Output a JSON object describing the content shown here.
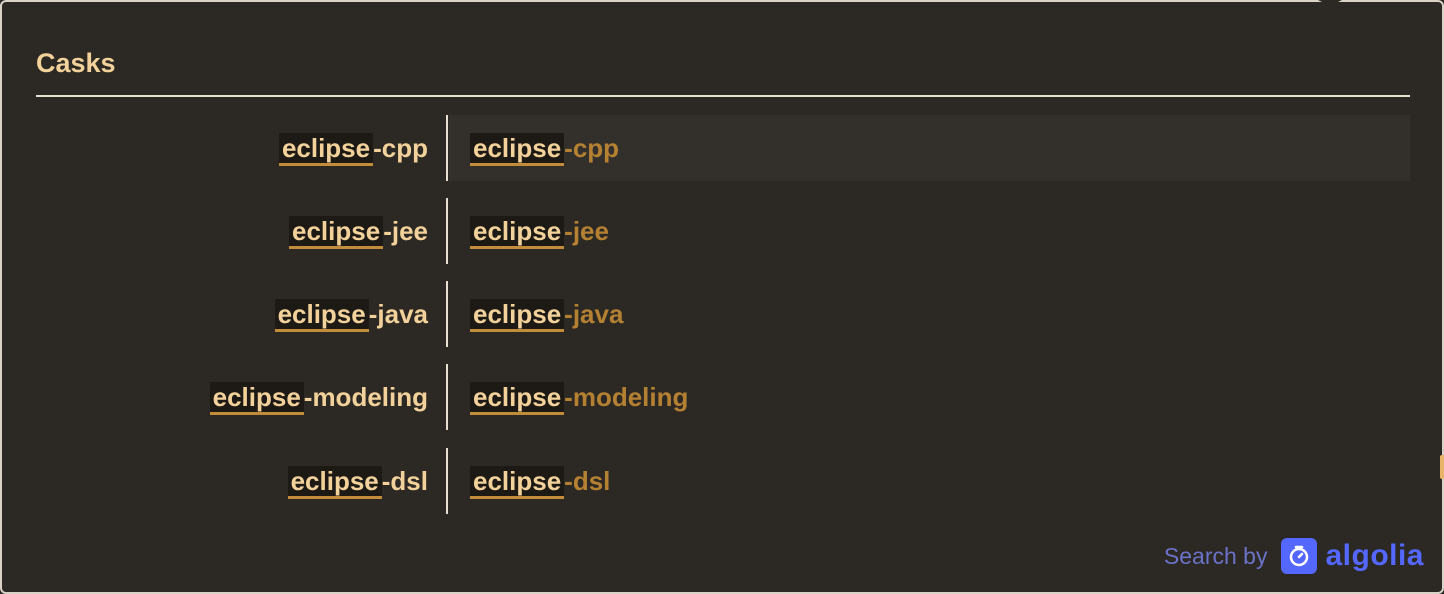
{
  "category": {
    "title": "Casks"
  },
  "results": [
    {
      "left_match": "eclipse",
      "left_rest": "-cpp",
      "right_match": "eclipse",
      "right_rest": "-cpp",
      "active": true
    },
    {
      "left_match": "eclipse",
      "left_rest": "-jee",
      "right_match": "eclipse",
      "right_rest": "-jee",
      "active": false
    },
    {
      "left_match": "eclipse",
      "left_rest": "-java",
      "right_match": "eclipse",
      "right_rest": "-java",
      "active": false
    },
    {
      "left_match": "eclipse",
      "left_rest": "-modeling",
      "right_match": "eclipse",
      "right_rest": "-modeling",
      "active": false
    },
    {
      "left_match": "eclipse",
      "left_rest": "-dsl",
      "right_match": "eclipse",
      "right_rest": "-dsl",
      "active": false
    }
  ],
  "footer": {
    "search_by": "Search by",
    "brand": "algolia",
    "brand_icon": "algolia-stopwatch-icon",
    "brand_color": "#5468ff"
  },
  "colors": {
    "background": "#2c2823",
    "title": "#f2d29a",
    "match_text": "#f2d29a",
    "secondary_text": "#b48133",
    "underline": "#c28c3a"
  }
}
